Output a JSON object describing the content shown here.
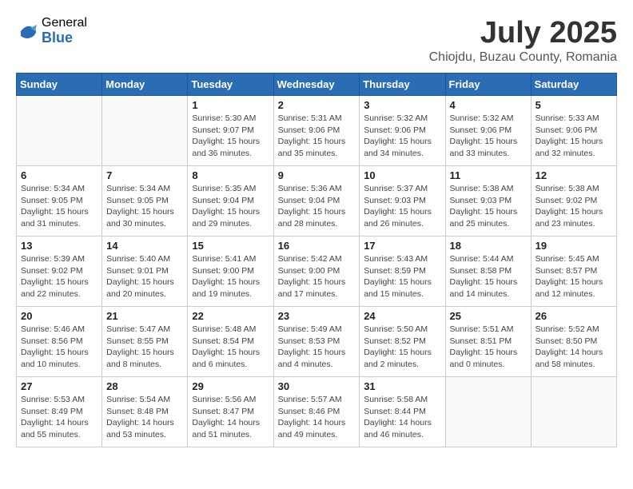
{
  "logo": {
    "general": "General",
    "blue": "Blue"
  },
  "title": "July 2025",
  "location": "Chiojdu, Buzau County, Romania",
  "headers": [
    "Sunday",
    "Monday",
    "Tuesday",
    "Wednesday",
    "Thursday",
    "Friday",
    "Saturday"
  ],
  "weeks": [
    [
      {
        "day": "",
        "detail": ""
      },
      {
        "day": "",
        "detail": ""
      },
      {
        "day": "1",
        "detail": "Sunrise: 5:30 AM\nSunset: 9:07 PM\nDaylight: 15 hours\nand 36 minutes."
      },
      {
        "day": "2",
        "detail": "Sunrise: 5:31 AM\nSunset: 9:06 PM\nDaylight: 15 hours\nand 35 minutes."
      },
      {
        "day": "3",
        "detail": "Sunrise: 5:32 AM\nSunset: 9:06 PM\nDaylight: 15 hours\nand 34 minutes."
      },
      {
        "day": "4",
        "detail": "Sunrise: 5:32 AM\nSunset: 9:06 PM\nDaylight: 15 hours\nand 33 minutes."
      },
      {
        "day": "5",
        "detail": "Sunrise: 5:33 AM\nSunset: 9:06 PM\nDaylight: 15 hours\nand 32 minutes."
      }
    ],
    [
      {
        "day": "6",
        "detail": "Sunrise: 5:34 AM\nSunset: 9:05 PM\nDaylight: 15 hours\nand 31 minutes."
      },
      {
        "day": "7",
        "detail": "Sunrise: 5:34 AM\nSunset: 9:05 PM\nDaylight: 15 hours\nand 30 minutes."
      },
      {
        "day": "8",
        "detail": "Sunrise: 5:35 AM\nSunset: 9:04 PM\nDaylight: 15 hours\nand 29 minutes."
      },
      {
        "day": "9",
        "detail": "Sunrise: 5:36 AM\nSunset: 9:04 PM\nDaylight: 15 hours\nand 28 minutes."
      },
      {
        "day": "10",
        "detail": "Sunrise: 5:37 AM\nSunset: 9:03 PM\nDaylight: 15 hours\nand 26 minutes."
      },
      {
        "day": "11",
        "detail": "Sunrise: 5:38 AM\nSunset: 9:03 PM\nDaylight: 15 hours\nand 25 minutes."
      },
      {
        "day": "12",
        "detail": "Sunrise: 5:38 AM\nSunset: 9:02 PM\nDaylight: 15 hours\nand 23 minutes."
      }
    ],
    [
      {
        "day": "13",
        "detail": "Sunrise: 5:39 AM\nSunset: 9:02 PM\nDaylight: 15 hours\nand 22 minutes."
      },
      {
        "day": "14",
        "detail": "Sunrise: 5:40 AM\nSunset: 9:01 PM\nDaylight: 15 hours\nand 20 minutes."
      },
      {
        "day": "15",
        "detail": "Sunrise: 5:41 AM\nSunset: 9:00 PM\nDaylight: 15 hours\nand 19 minutes."
      },
      {
        "day": "16",
        "detail": "Sunrise: 5:42 AM\nSunset: 9:00 PM\nDaylight: 15 hours\nand 17 minutes."
      },
      {
        "day": "17",
        "detail": "Sunrise: 5:43 AM\nSunset: 8:59 PM\nDaylight: 15 hours\nand 15 minutes."
      },
      {
        "day": "18",
        "detail": "Sunrise: 5:44 AM\nSunset: 8:58 PM\nDaylight: 15 hours\nand 14 minutes."
      },
      {
        "day": "19",
        "detail": "Sunrise: 5:45 AM\nSunset: 8:57 PM\nDaylight: 15 hours\nand 12 minutes."
      }
    ],
    [
      {
        "day": "20",
        "detail": "Sunrise: 5:46 AM\nSunset: 8:56 PM\nDaylight: 15 hours\nand 10 minutes."
      },
      {
        "day": "21",
        "detail": "Sunrise: 5:47 AM\nSunset: 8:55 PM\nDaylight: 15 hours\nand 8 minutes."
      },
      {
        "day": "22",
        "detail": "Sunrise: 5:48 AM\nSunset: 8:54 PM\nDaylight: 15 hours\nand 6 minutes."
      },
      {
        "day": "23",
        "detail": "Sunrise: 5:49 AM\nSunset: 8:53 PM\nDaylight: 15 hours\nand 4 minutes."
      },
      {
        "day": "24",
        "detail": "Sunrise: 5:50 AM\nSunset: 8:52 PM\nDaylight: 15 hours\nand 2 minutes."
      },
      {
        "day": "25",
        "detail": "Sunrise: 5:51 AM\nSunset: 8:51 PM\nDaylight: 15 hours\nand 0 minutes."
      },
      {
        "day": "26",
        "detail": "Sunrise: 5:52 AM\nSunset: 8:50 PM\nDaylight: 14 hours\nand 58 minutes."
      }
    ],
    [
      {
        "day": "27",
        "detail": "Sunrise: 5:53 AM\nSunset: 8:49 PM\nDaylight: 14 hours\nand 55 minutes."
      },
      {
        "day": "28",
        "detail": "Sunrise: 5:54 AM\nSunset: 8:48 PM\nDaylight: 14 hours\nand 53 minutes."
      },
      {
        "day": "29",
        "detail": "Sunrise: 5:56 AM\nSunset: 8:47 PM\nDaylight: 14 hours\nand 51 minutes."
      },
      {
        "day": "30",
        "detail": "Sunrise: 5:57 AM\nSunset: 8:46 PM\nDaylight: 14 hours\nand 49 minutes."
      },
      {
        "day": "31",
        "detail": "Sunrise: 5:58 AM\nSunset: 8:44 PM\nDaylight: 14 hours\nand 46 minutes."
      },
      {
        "day": "",
        "detail": ""
      },
      {
        "day": "",
        "detail": ""
      }
    ]
  ]
}
